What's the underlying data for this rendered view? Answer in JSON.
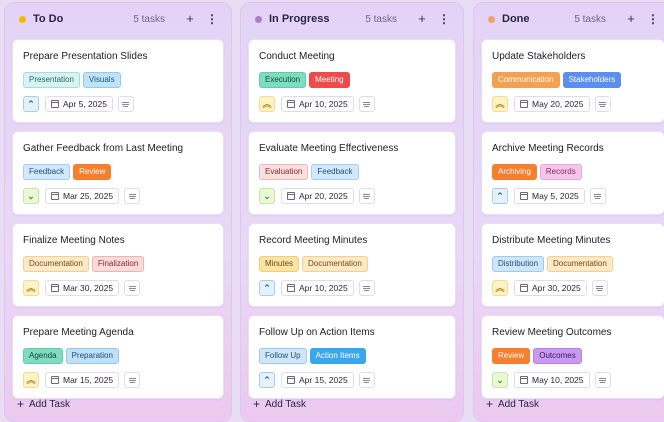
{
  "columns": [
    {
      "title": "To Do",
      "count": "5 tasks",
      "dot_color": "#f5b800",
      "add_label": "Add Task",
      "cards": [
        {
          "title": "Prepare Presentation Slides",
          "tags": [
            {
              "label": "Presentation",
              "bg": "#d8f3f1",
              "fg": "#1f6e6a",
              "bd": "#a7dcd7"
            },
            {
              "label": "Visuals",
              "bg": "#bfe3f7",
              "fg": "#1b5a80",
              "bd": "#8fcbea"
            }
          ],
          "priority": "medium",
          "priority_icon": "chevron-up",
          "date": "Apr 5, 2025"
        },
        {
          "title": "Gather Feedback from Last Meeting",
          "tags": [
            {
              "label": "Feedback",
              "bg": "#d3e9fb",
              "fg": "#1b4f80",
              "bd": "#a5cdf0"
            },
            {
              "label": "Review",
              "bg": "#f57f2e",
              "fg": "#ffffff",
              "bd": "#f57f2e"
            }
          ],
          "priority": "low",
          "priority_icon": "chevron-down",
          "date": "Mar 25, 2025"
        },
        {
          "title": "Finalize Meeting Notes",
          "tags": [
            {
              "label": "Documentation",
              "bg": "#fde9c9",
              "fg": "#7a4a08",
              "bd": "#f5cf8e"
            },
            {
              "label": "Finalization",
              "bg": "#fbdada",
              "fg": "#8a2c2c",
              "bd": "#f2b2b2"
            }
          ],
          "priority": "high",
          "priority_icon": "double-chevron-up",
          "date": "Mar 30, 2025"
        },
        {
          "title": "Prepare Meeting Agenda",
          "tags": [
            {
              "label": "Agenda",
              "bg": "#7fdcbf",
              "fg": "#0f4a3a",
              "bd": "#5fcdaa"
            },
            {
              "label": "Preparation",
              "bg": "#bfe0f7",
              "fg": "#1b4f80",
              "bd": "#93c7ec"
            }
          ],
          "priority": "high",
          "priority_icon": "double-chevron-up",
          "date": "Mar 15, 2025"
        }
      ]
    },
    {
      "title": "In Progress",
      "count": "5 tasks",
      "dot_color": "#b07ad0",
      "add_label": "Add Task",
      "cards": [
        {
          "title": "Conduct Meeting",
          "tags": [
            {
              "label": "Execution",
              "bg": "#7fdcbf",
              "fg": "#0f4a3a",
              "bd": "#5fcdaa"
            },
            {
              "label": "Meeting",
              "bg": "#ef4b4b",
              "fg": "#ffffff",
              "bd": "#ef4b4b"
            }
          ],
          "priority": "high",
          "priority_icon": "double-chevron-up",
          "date": "Apr 10, 2025"
        },
        {
          "title": "Evaluate Meeting Effectiveness",
          "tags": [
            {
              "label": "Evaluation",
              "bg": "#fbdede",
              "fg": "#8a2c2c",
              "bd": "#f2b8b8"
            },
            {
              "label": "Feedback",
              "bg": "#d3e9fb",
              "fg": "#1b4f80",
              "bd": "#a5cdf0"
            }
          ],
          "priority": "low",
          "priority_icon": "chevron-down",
          "date": "Apr 20, 2025"
        },
        {
          "title": "Record Meeting Minutes",
          "tags": [
            {
              "label": "Minutes",
              "bg": "#fde3a8",
              "fg": "#6e4a05",
              "bd": "#f5cd6e"
            },
            {
              "label": "Documentation",
              "bg": "#fde9c9",
              "fg": "#7a4a08",
              "bd": "#f5cf8e"
            }
          ],
          "priority": "medium",
          "priority_icon": "chevron-up",
          "date": "Apr 10, 2025"
        },
        {
          "title": "Follow Up on Action Items",
          "tags": [
            {
              "label": "Follow Up",
              "bg": "#cfe6f8",
              "fg": "#1b4f80",
              "bd": "#9fcaee"
            },
            {
              "label": "Action Items",
              "bg": "#3aa6ee",
              "fg": "#ffffff",
              "bd": "#3aa6ee"
            }
          ],
          "priority": "medium",
          "priority_icon": "chevron-up",
          "date": "Apr 15, 2025"
        }
      ]
    },
    {
      "title": "Done",
      "count": "5 tasks",
      "dot_color": "#f4a06a",
      "add_label": "Add Task",
      "cards": [
        {
          "title": "Update Stakeholders",
          "tags": [
            {
              "label": "Communication",
              "bg": "#f5a050",
              "fg": "#ffffff",
              "bd": "#f5a050"
            },
            {
              "label": "Stakeholders",
              "bg": "#5a8ff0",
              "fg": "#ffffff",
              "bd": "#5a8ff0"
            }
          ],
          "priority": "high",
          "priority_icon": "double-chevron-up",
          "date": "May 20, 2025"
        },
        {
          "title": "Archive Meeting Records",
          "tags": [
            {
              "label": "Archiving",
              "bg": "#f57f2e",
              "fg": "#ffffff",
              "bd": "#f57f2e"
            },
            {
              "label": "Records",
              "bg": "#f5c6ea",
              "fg": "#7a2a68",
              "bd": "#eaa6dc"
            }
          ],
          "priority": "medium",
          "priority_icon": "chevron-up",
          "date": "May 5, 2025"
        },
        {
          "title": "Distribute Meeting Minutes",
          "tags": [
            {
              "label": "Distribution",
              "bg": "#cfe6f8",
              "fg": "#1b4f80",
              "bd": "#9fcaee"
            },
            {
              "label": "Documentation",
              "bg": "#fde9c9",
              "fg": "#7a4a08",
              "bd": "#f5cf8e"
            }
          ],
          "priority": "high",
          "priority_icon": "double-chevron-up",
          "date": "Apr 30, 2025"
        },
        {
          "title": "Review Meeting Outcomes",
          "tags": [
            {
              "label": "Review",
              "bg": "#f57f2e",
              "fg": "#ffffff",
              "bd": "#f57f2e"
            },
            {
              "label": "Outcomes",
              "bg": "#c99af0",
              "fg": "#3a1560",
              "bd": "#b37ee6"
            }
          ],
          "priority": "low",
          "priority_icon": "chevron-down",
          "date": "May 10, 2025"
        }
      ]
    }
  ],
  "icons": {
    "add": "+",
    "more": "⋮",
    "chevron-up": "⌃",
    "chevron-down": "⌄",
    "double-chevron-up": "︽"
  }
}
